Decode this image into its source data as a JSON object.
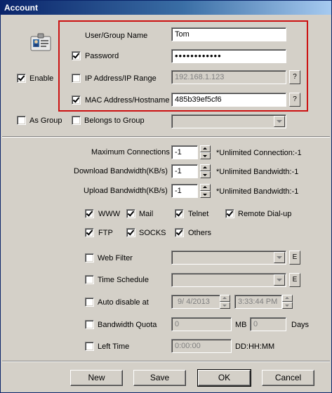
{
  "window": {
    "title": "Account"
  },
  "credentials": {
    "user_label": "User/Group Name",
    "user_value": "Tom",
    "password_label": "Password",
    "password_value": "••••••••••••",
    "ip_label": "IP Address/IP Range",
    "ip_value": "192.168.1.123",
    "mac_label": "MAC Address/Hostname",
    "mac_value": "485b39ef5cf6",
    "browse_label": "?",
    "enable_label": "Enable",
    "as_group_label": "As Group",
    "belongs_label": "Belongs to Group",
    "checked": {
      "password": true,
      "ip": false,
      "mac": true,
      "enable": true,
      "as_group": false,
      "belongs": false
    }
  },
  "limits": {
    "max_conn_label": "Maximum Connections",
    "max_conn_value": "-1",
    "max_conn_note": "*Unlimited Connection:-1",
    "download_label": "Download Bandwidth(KB/s)",
    "download_value": "-1",
    "download_note": "*Unlimited Bandwidth:-1",
    "upload_label": "Upload Bandwidth(KB/s)",
    "upload_value": "-1",
    "upload_note": "*Unlimited Bandwidth:-1"
  },
  "services": {
    "www": "WWW",
    "mail": "Mail",
    "telnet": "Telnet",
    "remote": "Remote Dial-up",
    "ftp": "FTP",
    "socks": "SOCKS",
    "others": "Others",
    "checked": {
      "www": true,
      "mail": true,
      "telnet": true,
      "remote": true,
      "ftp": true,
      "socks": true,
      "others": true
    }
  },
  "options": {
    "web_filter_label": "Web Filter",
    "time_schedule_label": "Time Schedule",
    "edit_label": "E",
    "auto_disable_label": "Auto disable at",
    "auto_date": "9/  4/2013",
    "auto_time": "3:33:44 PM",
    "quota_label": "Bandwidth Quota",
    "quota_value": "0",
    "quota_unit": "MB",
    "quota_days": "0",
    "days_unit": "Days",
    "left_time_label": "Left Time",
    "left_time_value": "0:00:00",
    "left_time_format": "DD:HH:MM",
    "checked": {
      "web_filter": false,
      "time_schedule": false,
      "auto_disable": false,
      "quota": false,
      "left_time": false
    }
  },
  "buttons": {
    "new": "New",
    "save": "Save",
    "ok": "OK",
    "cancel": "Cancel"
  },
  "colors": {
    "highlight_box": "#cc1111",
    "title_bar": "#0a246a"
  }
}
